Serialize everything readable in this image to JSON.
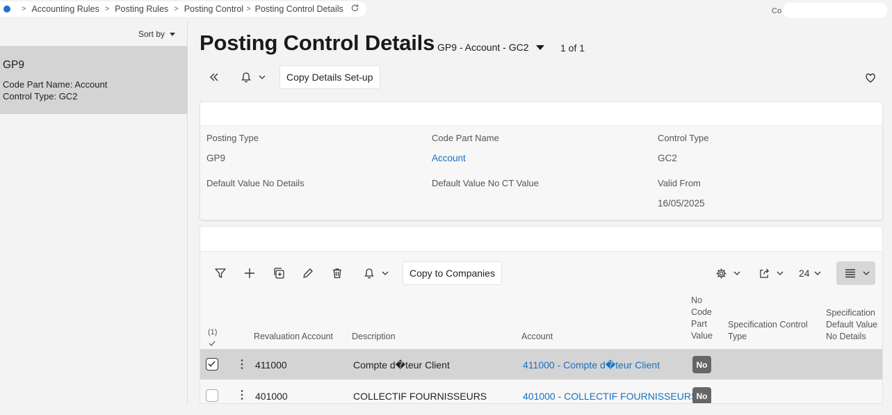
{
  "breadcrumb": {
    "items": [
      "Accounting Rules",
      "Posting Rules",
      "Posting Control",
      "Posting Control Details"
    ]
  },
  "user": {
    "company_prefix": "Co"
  },
  "left_panel": {
    "sort_label": "Sort by",
    "item": {
      "title": "GP9",
      "line1": "Code Part Name:  Account",
      "line2": "Control Type:  GC2"
    }
  },
  "header": {
    "title": "Posting Control Details",
    "record_selector": "GP9 - Account - GC2",
    "record_count": "1 of 1",
    "copy_details_label": "Copy Details Set-up"
  },
  "details": {
    "posting_type_label": "Posting Type",
    "posting_type_value": "GP9",
    "code_part_name_label": "Code Part Name",
    "code_part_name_value": "Account",
    "control_type_label": "Control Type",
    "control_type_value": "GC2",
    "default_no_details_label": "Default Value No Details",
    "default_no_ct_label": "Default Value No CT Value",
    "valid_from_label": "Valid From",
    "valid_from_value": "16/05/2025"
  },
  "table": {
    "copy_companies_label": "Copy to Companies",
    "page_size": "24",
    "selected_count": "(1)",
    "columns": {
      "revaluation_account": "Revaluation Account",
      "description": "Description",
      "account": "Account",
      "no_code_part_value": [
        "No",
        "Code",
        "Part",
        "Value"
      ],
      "spec_control_type": [
        "Specification Control",
        "Type"
      ],
      "spec_default_value": [
        "Specification",
        "Default Value",
        "No Details"
      ]
    },
    "rows": [
      {
        "revaluation_account": "411000",
        "description": "Compte d�teur Client",
        "account": "411000 - Compte d�teur Client",
        "no_code_part_value": "No",
        "checked": true
      },
      {
        "revaluation_account": "401000",
        "description": "COLLECTIF FOURNISSEURS",
        "account": "401000 - COLLECTIF FOURNISSEURS",
        "no_code_part_value": "No",
        "checked": false
      }
    ]
  },
  "colors": {
    "link": "#1a6fc1",
    "selected_row": "#d4d4d4",
    "badge": "#666666",
    "home_dot": "#1f6fd1"
  },
  "icons": [
    "home-icon",
    "refresh-icon",
    "double-chevron-left-icon",
    "bell-icon",
    "heart-icon",
    "filter-icon",
    "plus-icon",
    "duplicate-icon",
    "pencil-icon",
    "trash-icon",
    "gear-icon",
    "export-icon",
    "list-density-icon",
    "kebab-icon",
    "checkmark-icon"
  ]
}
